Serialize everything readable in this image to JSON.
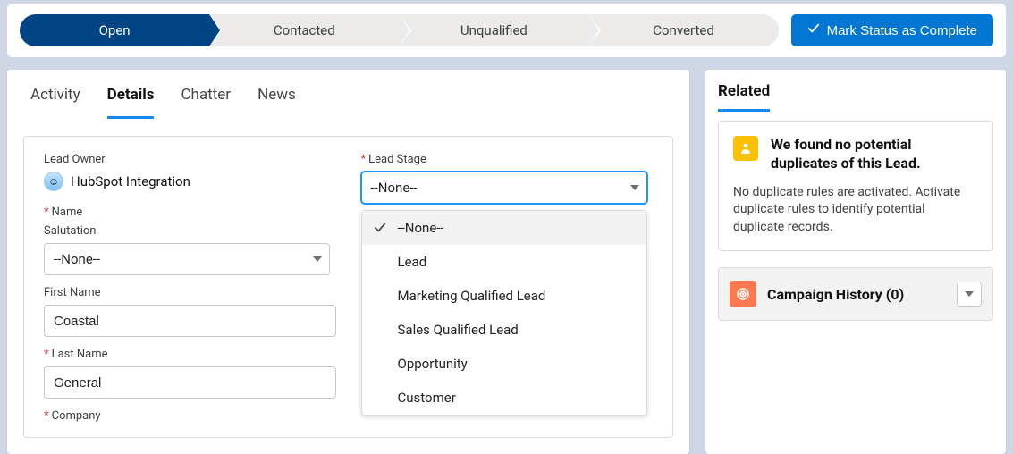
{
  "path": {
    "steps": [
      {
        "label": "Open",
        "active": true
      },
      {
        "label": "Contacted",
        "active": false
      },
      {
        "label": "Unqualified",
        "active": false
      },
      {
        "label": "Converted",
        "active": false
      }
    ],
    "complete_button": "Mark Status as Complete"
  },
  "tabs": [
    {
      "label": "Activity",
      "active": false
    },
    {
      "label": "Details",
      "active": true
    },
    {
      "label": "Chatter",
      "active": false
    },
    {
      "label": "News",
      "active": false
    }
  ],
  "form": {
    "lead_owner_label": "Lead Owner",
    "lead_owner_value": "HubSpot Integration",
    "name_label": "Name",
    "salutation_label": "Salutation",
    "salutation_value": "--None--",
    "first_name_label": "First Name",
    "first_name_value": "Coastal",
    "last_name_label": "Last Name",
    "last_name_value": "General",
    "company_label": "Company",
    "lead_stage_label": "Lead Stage",
    "lead_stage_value": "--None--",
    "lead_stage_options": [
      "--None--",
      "Lead",
      "Marketing Qualified Lead",
      "Sales Qualified Lead",
      "Opportunity",
      "Customer"
    ]
  },
  "related": {
    "title": "Related",
    "dup_title": "We found no potential duplicates of this Lead.",
    "dup_text": "No duplicate rules are activated. Activate duplicate rules to identify potential duplicate records.",
    "campaign_title": "Campaign History (0)"
  }
}
